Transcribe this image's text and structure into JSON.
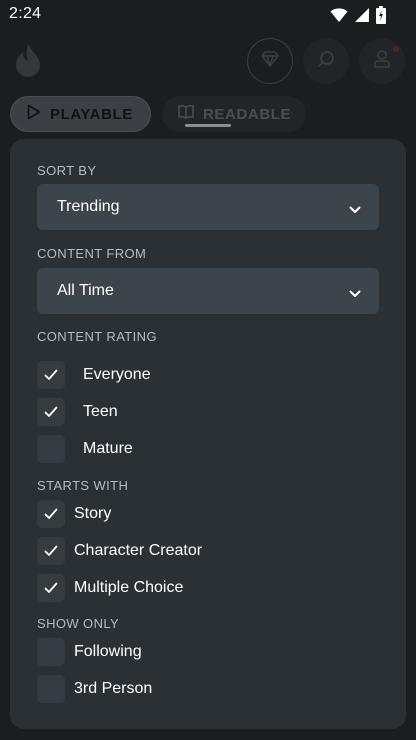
{
  "status_bar": {
    "time": "2:24",
    "icons": [
      "wifi-icon",
      "signal-icon",
      "battery-icon"
    ]
  },
  "header": {
    "icons": [
      "flame-logo-icon",
      "gem-icon",
      "search-icon",
      "profile-icon"
    ]
  },
  "tabs": [
    {
      "label": "PLAYABLE",
      "icon": "play-icon",
      "selected": true
    },
    {
      "label": "READABLE",
      "icon": "book-icon",
      "selected": false
    }
  ],
  "filters": {
    "sort_by": {
      "label": "SORT BY",
      "value": "Trending"
    },
    "content_from": {
      "label": "CONTENT FROM",
      "value": "All Time"
    },
    "content_rating": {
      "label": "CONTENT RATING",
      "options": [
        {
          "label": "Everyone",
          "checked": true
        },
        {
          "label": "Teen",
          "checked": true
        },
        {
          "label": "Mature",
          "checked": false
        }
      ]
    },
    "starts_with": {
      "label": "STARTS WITH",
      "options": [
        {
          "label": "Story",
          "checked": true
        },
        {
          "label": "Character Creator",
          "checked": true
        },
        {
          "label": "Multiple Choice",
          "checked": true
        }
      ]
    },
    "show_only": {
      "label": "SHOW ONLY",
      "options": [
        {
          "label": "Following",
          "checked": false
        },
        {
          "label": "3rd Person",
          "checked": false
        }
      ]
    }
  },
  "colors": {
    "background": "#1b1e21",
    "panel": "#2b3035",
    "select": "#3c444c",
    "checkbox": "#353b41",
    "text": "#ffffff",
    "section_label": "#b7bcc1"
  }
}
